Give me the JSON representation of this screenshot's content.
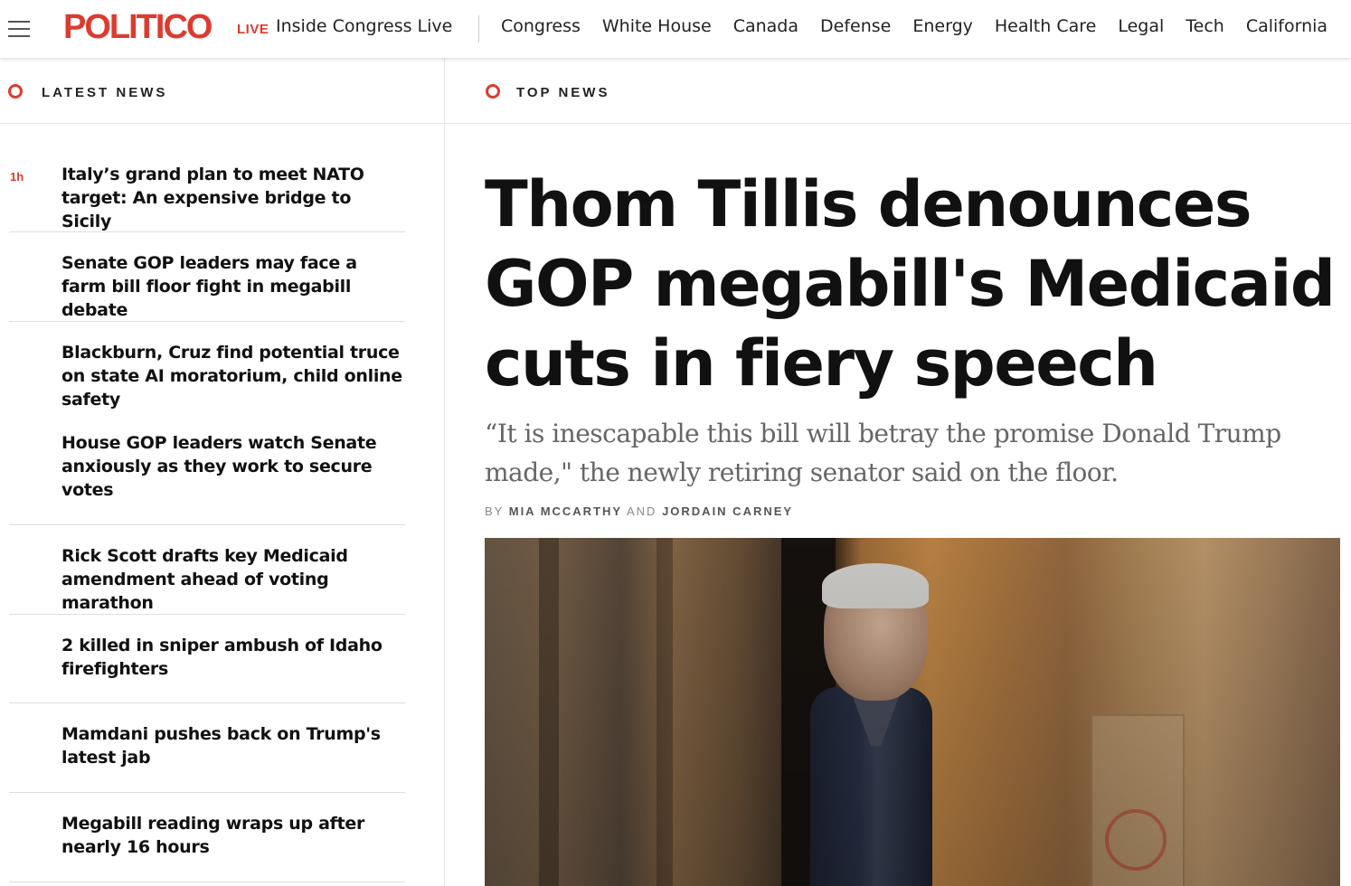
{
  "nav": {
    "brand": "POLITICO",
    "live_tag": "LIVE",
    "live_link": "Inside Congress Live",
    "links": [
      "Congress",
      "White House",
      "Canada",
      "Defense",
      "Energy",
      "Health Care",
      "Legal",
      "Tech",
      "California"
    ]
  },
  "latest": {
    "label": "LATEST NEWS",
    "items": [
      {
        "time": "1h",
        "headline": "Italy’s grand plan to meet NATO target: An expensive bridge to Sicily"
      },
      {
        "time": "",
        "headline": "Senate GOP leaders may face a farm bill floor fight in megabill debate"
      },
      {
        "time": "",
        "headline": "Blackburn, Cruz find potential truce on state AI moratorium, child online safety"
      },
      {
        "time": "",
        "headline": "House GOP leaders watch Senate anxiously as they work to secure votes"
      },
      {
        "time": "",
        "headline": "Rick Scott drafts key Medicaid amendment ahead of voting marathon"
      },
      {
        "time": "",
        "headline": "2 killed in sniper ambush of Idaho firefighters"
      },
      {
        "time": "",
        "headline": "Mamdani pushes back on Trump's latest jab"
      },
      {
        "time": "",
        "headline": "Megabill reading wraps up after nearly 16 hours"
      }
    ]
  },
  "top": {
    "label": "TOP NEWS",
    "headline": "Thom Tillis denounces GOP megabill's Medicaid cuts in fiery speech",
    "dek": "“It is inescapable this bill will betray the promise Donald Trump made,\" the newly retiring senator said on the floor.",
    "byline_by": "BY",
    "author1": "MIA MCCARTHY",
    "byline_and": "AND",
    "author2": "JORDAIN CARNEY"
  },
  "colors": {
    "brand_red": "#dc3b2f"
  }
}
